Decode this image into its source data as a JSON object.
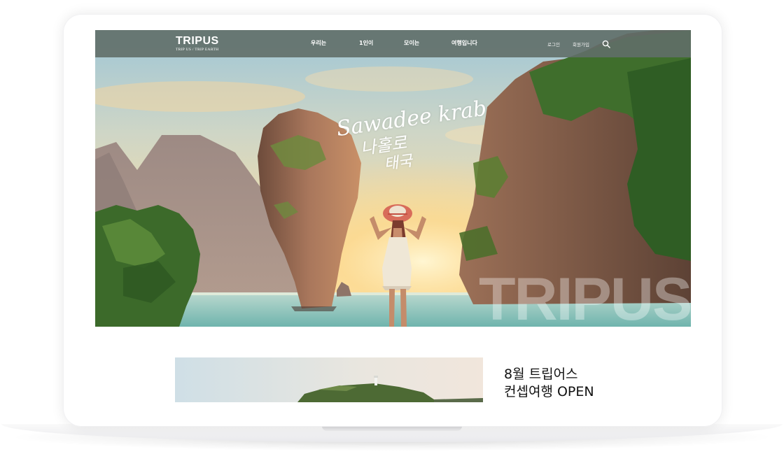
{
  "brand": {
    "logo": "TRIPUS",
    "tagline": "TRIP US / TRIP EARTH",
    "watermark": "TRIPUS"
  },
  "nav": {
    "items": [
      {
        "label": "우리는"
      },
      {
        "label": "1인이"
      },
      {
        "label": "모이는"
      },
      {
        "label": "여행입니다"
      }
    ]
  },
  "utility": {
    "login": "로그인",
    "signup": "회원가입",
    "search_icon": "search-icon"
  },
  "hero": {
    "script_line1": "Sawadee krab",
    "script_line2": "나홀로",
    "script_line3": "태국"
  },
  "promo": {
    "line1": "8월 트립어스",
    "line2": "컨셉여행 OPEN"
  },
  "colors": {
    "header_bg": "#606e68",
    "text_dark": "#111111",
    "white": "#ffffff"
  }
}
